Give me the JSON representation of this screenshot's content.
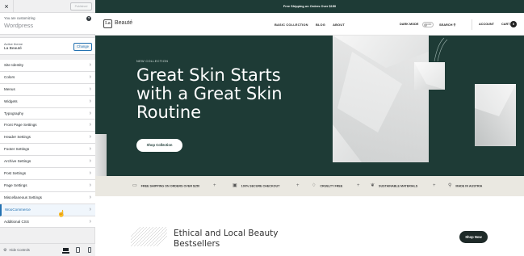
{
  "sidebar": {
    "close_icon": "×",
    "publish_label": "Published",
    "customizing_label": "You are customizing",
    "site_name": "Wordpress",
    "help_icon": "?",
    "active_theme_label": "Active theme",
    "active_theme_name": "La Beauté",
    "change_label": "Change",
    "menu_items": [
      {
        "label": "Site Identity"
      },
      {
        "label": "Colors"
      },
      {
        "label": "Menus"
      },
      {
        "label": "Widgets"
      },
      {
        "label": "Typography"
      },
      {
        "label": "Front Page Settings"
      },
      {
        "label": "Header Settings"
      },
      {
        "label": "Footer Settings"
      },
      {
        "label": "Archive Settings"
      },
      {
        "label": "Post Settings"
      },
      {
        "label": "Page Settings"
      },
      {
        "label": "Miscellaneous Settings"
      },
      {
        "label": "WooCommerce",
        "active": true
      },
      {
        "label": "Additional CSS"
      }
    ],
    "chevron": "›",
    "hide_controls_label": "Hide Controls",
    "gear_icon": "⚙",
    "accent_color": "#2271b1"
  },
  "preview": {
    "announcement": "Free Shipping on Orders Over $150",
    "logo_mark": "La",
    "logo_text": "Beauté",
    "nav": [
      "BASIC COLLECTION",
      "BLOG",
      "ABOUT"
    ],
    "dark_mode_label": "DARK MODE",
    "toggle_state": "OFF",
    "search_label": "SEARCH",
    "search_icon": "⚲",
    "account_label": "ACCOUNT",
    "cart_label": "CART",
    "cart_count": "0",
    "hero": {
      "eyebrow": "NEW COLLECTION",
      "title": "Great Skin Starts with a Great Skin Routine",
      "button": "Shop Collection",
      "bg_color": "#1e3b36"
    },
    "features": [
      {
        "icon": "▭",
        "label": "FREE SHIPPING ON ORDERS OVER $150"
      },
      {
        "icon": "▣",
        "label": "100% SECURE CHECKOUT"
      },
      {
        "icon": "♢",
        "label": "CRUELTY FREE"
      },
      {
        "icon": "❦",
        "label": "SUSTAINABLE MATERIALS"
      },
      {
        "icon": "⚲",
        "label": "MADE IN AUSTRIA"
      }
    ],
    "feature_separator": "+",
    "bestsellers_title": "Ethical and Local Beauty Bestsellers",
    "shop_now": "Shop Now"
  }
}
